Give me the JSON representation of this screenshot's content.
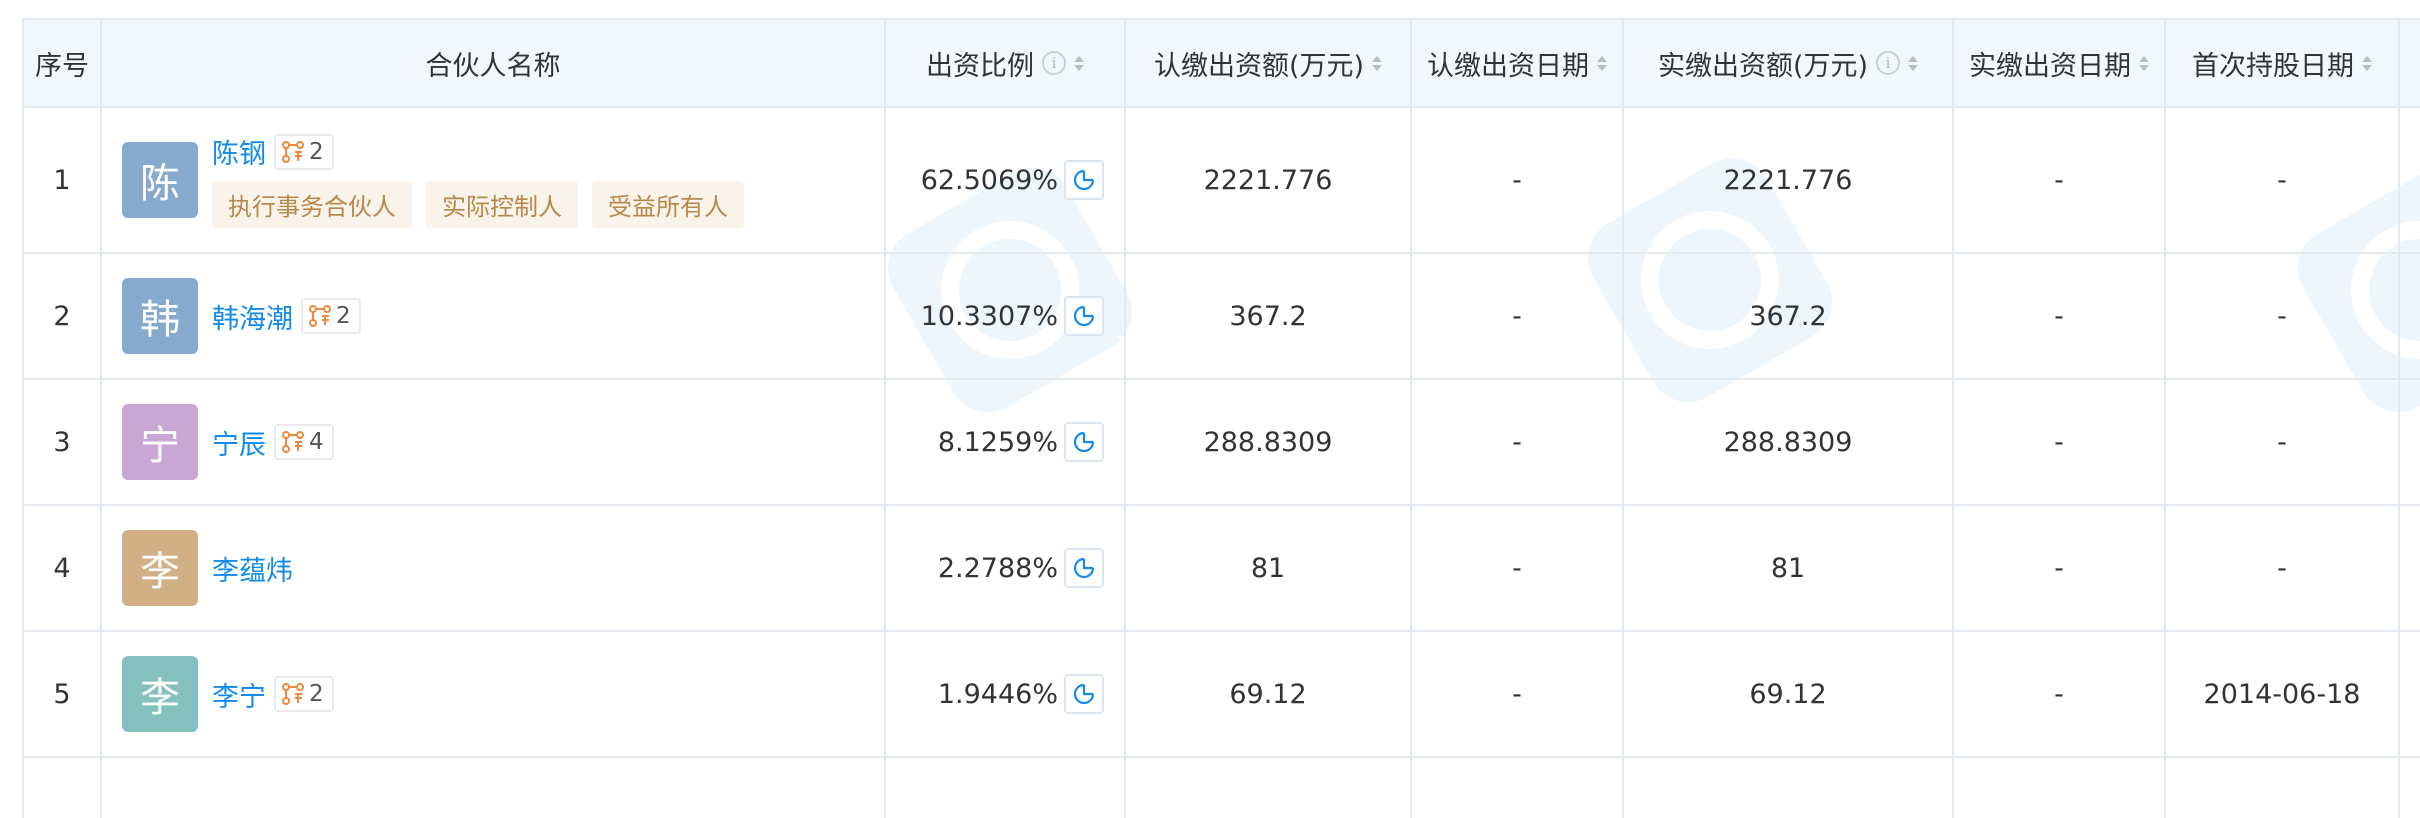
{
  "headers": {
    "no": "序号",
    "name": "合伙人名称",
    "ratio": "出资比例",
    "subscribed": "认缴出资额(万元)",
    "subscribed_date": "认缴出资日期",
    "paid": "实缴出资额(万元)",
    "paid_date": "实缴出资日期",
    "first_hold": "首次持股日期"
  },
  "rows": [
    {
      "no": "1",
      "avatar_char": "陈",
      "avatar_color": "#86a9cd",
      "name": "陈钢",
      "rel_count": "2",
      "tags": [
        "执行事务合伙人",
        "实际控制人",
        "受益所有人"
      ],
      "ratio": "62.5069%",
      "subscribed": "2221.776",
      "subscribed_date": "-",
      "paid": "2221.776",
      "paid_date": "-",
      "first_hold": "-"
    },
    {
      "no": "2",
      "avatar_char": "韩",
      "avatar_color": "#86a9cd",
      "name": "韩海潮",
      "rel_count": "2",
      "ratio": "10.3307%",
      "subscribed": "367.2",
      "subscribed_date": "-",
      "paid": "367.2",
      "paid_date": "-",
      "first_hold": "-"
    },
    {
      "no": "3",
      "avatar_char": "宁",
      "avatar_color": "#c9a6d4",
      "name": "宁辰",
      "rel_count": "4",
      "ratio": "8.1259%",
      "subscribed": "288.8309",
      "subscribed_date": "-",
      "paid": "288.8309",
      "paid_date": "-",
      "first_hold": "-"
    },
    {
      "no": "4",
      "avatar_char": "李",
      "avatar_color": "#d1b085",
      "name": "李蕴炜",
      "ratio": "2.2788%",
      "subscribed": "81",
      "subscribed_date": "-",
      "paid": "81",
      "paid_date": "-",
      "first_hold": "-"
    },
    {
      "no": "5",
      "avatar_char": "李",
      "avatar_color": "#84c0bd",
      "name": "李宁",
      "rel_count": "2",
      "ratio": "1.9446%",
      "subscribed": "69.12",
      "subscribed_date": "-",
      "paid": "69.12",
      "paid_date": "-",
      "first_hold": "2014-06-18"
    }
  ],
  "icons": {
    "sort": "sort-icon",
    "info": "info-icon",
    "relation": "relation-graph-icon",
    "pie": "pie-chart-icon"
  },
  "colors": {
    "link": "#128bed",
    "header_bg": "#f2f7fc",
    "border": "#e4e9f1",
    "tag_bg": "#f9f3ea",
    "tag_text": "#b8884a",
    "relation_icon": "#f0883a"
  }
}
